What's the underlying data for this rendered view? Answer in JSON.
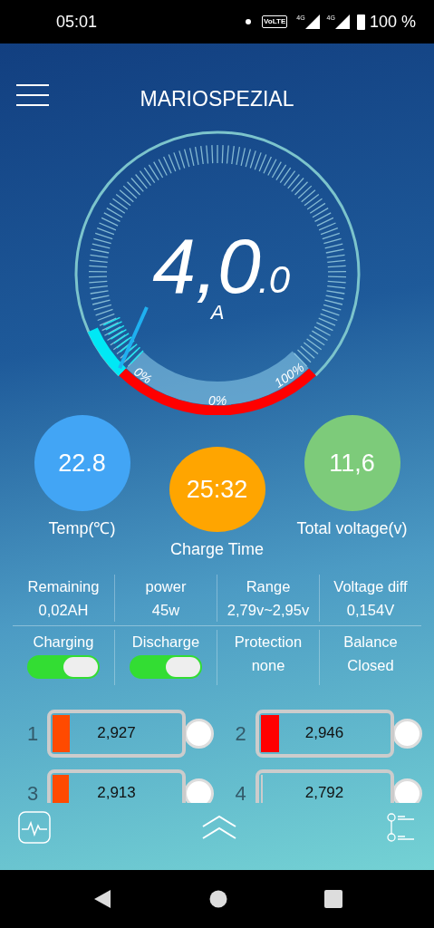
{
  "status_bar": {
    "time": "05:01",
    "volte": "VoLTE",
    "networks": [
      "4G",
      "4G"
    ],
    "battery": "100 %"
  },
  "header": {
    "title": "MARIOSPEZIAL"
  },
  "gauge": {
    "value": "4,0",
    "decimal": ".0",
    "unit": "A",
    "soc_labels": [
      "0%",
      "0%",
      "100%"
    ]
  },
  "circles": [
    {
      "value": "22.8",
      "label": "Temp(℃)",
      "color": "#42a5f5"
    },
    {
      "value": "25:32",
      "label": "Charge Time",
      "color": "#ffa500"
    },
    {
      "value": "11,6",
      "label": "Total voltage(v)",
      "color": "#7dcb7a"
    }
  ],
  "stats": [
    {
      "label": "Remaining",
      "value": "0,02AH"
    },
    {
      "label": "power",
      "value": "45w"
    },
    {
      "label": "Range",
      "value": "2,79v~2,95v"
    },
    {
      "label": "Voltage diff",
      "value": "0,154V"
    }
  ],
  "controls": [
    {
      "kind": "toggle",
      "label": "Charging",
      "on": true
    },
    {
      "kind": "toggle",
      "label": "Discharge",
      "on": true
    },
    {
      "kind": "text",
      "label": "Protection",
      "value": "none"
    },
    {
      "kind": "text",
      "label": "Balance",
      "value": "Closed"
    }
  ],
  "cells": [
    {
      "index": "1",
      "voltage": "2,927",
      "level": 0.13,
      "color": "#ff4a00"
    },
    {
      "index": "2",
      "voltage": "2,946",
      "level": 0.14,
      "color": "#ff0000"
    },
    {
      "index": "3",
      "voltage": "2,913",
      "level": 0.12,
      "color": "#ff4a00"
    },
    {
      "index": "4",
      "voltage": "2,792",
      "level": 0.02,
      "color": "#cccccc"
    }
  ]
}
